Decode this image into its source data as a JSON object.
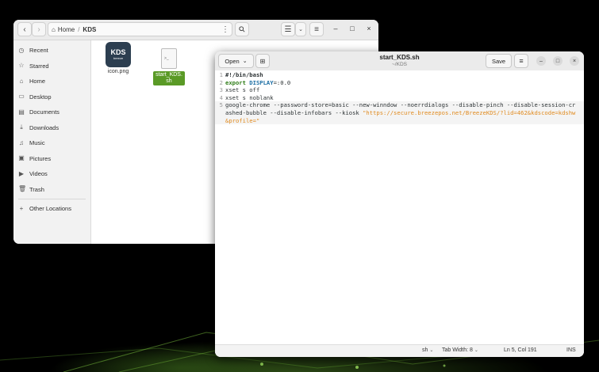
{
  "file_manager": {
    "path": {
      "home": "Home",
      "current": "KDS"
    },
    "window_controls": {
      "minimize": "–",
      "maximize": "□",
      "close": "×"
    },
    "sidebar": [
      {
        "label": "Recent",
        "icon": "clock-icon"
      },
      {
        "label": "Starred",
        "icon": "star-icon"
      },
      {
        "label": "Home",
        "icon": "home-icon"
      },
      {
        "label": "Desktop",
        "icon": "desktop-icon"
      },
      {
        "label": "Documents",
        "icon": "documents-icon"
      },
      {
        "label": "Downloads",
        "icon": "downloads-icon"
      },
      {
        "label": "Music",
        "icon": "music-icon"
      },
      {
        "label": "Pictures",
        "icon": "pictures-icon"
      },
      {
        "label": "Videos",
        "icon": "videos-icon"
      },
      {
        "label": "Trash",
        "icon": "trash-icon"
      }
    ],
    "other_locations": "Other Locations",
    "files": [
      {
        "name": "icon.png",
        "thumb_text": "KDS",
        "thumb_sub": "breeze",
        "selected": false
      },
      {
        "name": "start_KDS.sh",
        "thumb_text": ">_",
        "selected": true
      }
    ]
  },
  "editor": {
    "open_label": "Open",
    "title": "start_KDS.sh",
    "subtitle": "~/KDS",
    "save_label": "Save",
    "lines": [
      {
        "n": "1",
        "text": "#!/bin/bash"
      },
      {
        "n": "2",
        "kw": "export",
        "var": "DISPLAY",
        "rest": "=:0.0"
      },
      {
        "n": "3",
        "text": "xset s off"
      },
      {
        "n": "4",
        "text": "xset s noblank"
      },
      {
        "n": "5",
        "text": "google-chrome --password-store=basic --new-winndow --noerrdialogs --disable-pinch --disable-session-crashed-bubble --disable-infobars --kiosk ",
        "str": "\"https://secure.breezepos.net/BreezeKDS/?lid=462&kdscode=kdshw&profile=\""
      }
    ],
    "status": {
      "language": "sh",
      "tab_width": "Tab Width: 8",
      "position": "Ln 5, Col 191",
      "mode": "INS"
    }
  },
  "colors": {
    "selection": "#5a9a26",
    "string": "#e08a1e",
    "keyword": "#2f7d18",
    "variable": "#1c6ea4",
    "shebang": "#a0306b"
  }
}
